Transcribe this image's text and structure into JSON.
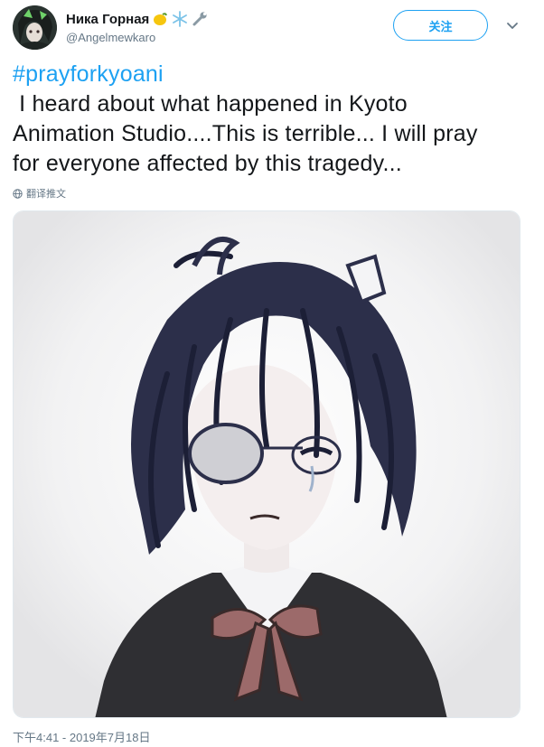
{
  "tweet": {
    "display_name": "Ника Горная",
    "name_emojis": [
      "lemon-emoji",
      "snowflake-emoji",
      "wrench-emoji"
    ],
    "handle": "@Angelmewkaro",
    "follow_label": "关注",
    "hashtag": "#prayforkyoani",
    "text_lines": [
      " I heard about what happened in Kyoto",
      "Animation Studio....This is terrible... I will pray",
      "for everyone affected by this tragedy..."
    ],
    "translate_label": "翻译推文",
    "timestamp": "下午4:41 - 2019年7月18日",
    "media_description_icon": "anime-girl-sketch"
  },
  "colors": {
    "accent": "#1da1f2",
    "secondary_text": "#657786",
    "primary_text": "#14171a",
    "border": "#e1e8ed"
  }
}
